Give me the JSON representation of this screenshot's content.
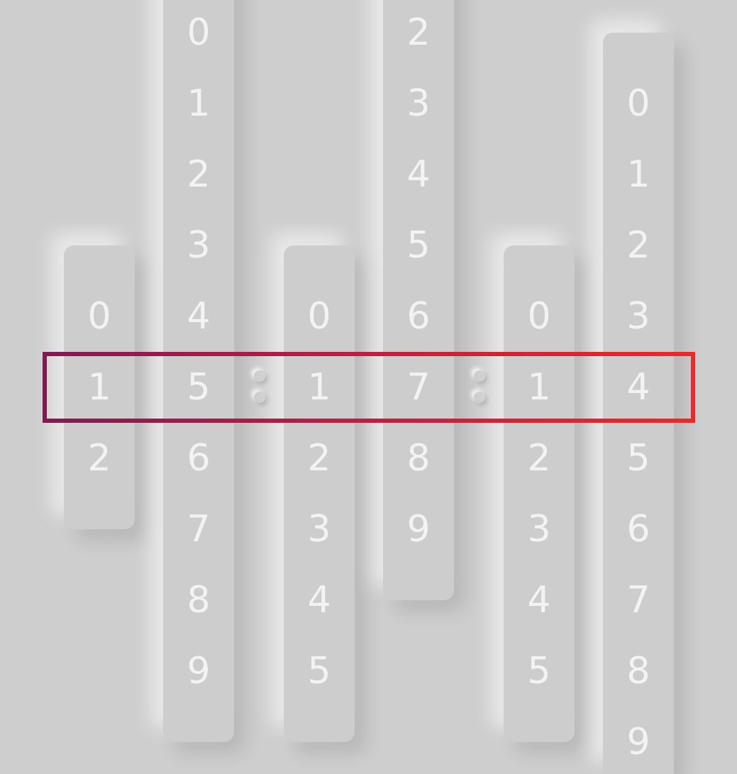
{
  "clock": {
    "columns": [
      {
        "name": "hours-tens",
        "digits": [
          "0",
          "1",
          "2"
        ],
        "selected": "1"
      },
      {
        "name": "hours-ones",
        "digits": [
          "0",
          "1",
          "2",
          "3",
          "4",
          "5",
          "6",
          "7",
          "8",
          "9"
        ],
        "selected": "5"
      },
      {
        "name": "minutes-tens",
        "digits": [
          "0",
          "1",
          "2",
          "3",
          "4",
          "5"
        ],
        "selected": "1"
      },
      {
        "name": "minutes-ones",
        "digits": [
          "2",
          "3",
          "4",
          "5",
          "6",
          "7",
          "8",
          "9"
        ],
        "selected": "7"
      },
      {
        "name": "seconds-tens",
        "digits": [
          "0",
          "1",
          "2",
          "3",
          "4",
          "5"
        ],
        "selected": "1"
      },
      {
        "name": "seconds-ones",
        "digits": [
          "0",
          "1",
          "2",
          "3",
          "4",
          "5",
          "6",
          "7",
          "8",
          "9"
        ],
        "selected": "4"
      }
    ]
  },
  "colors": {
    "background": "#cecece",
    "digit": "#f3f3f3",
    "highlight_start": "#7e1b52",
    "highlight_end": "#e92a2a"
  }
}
